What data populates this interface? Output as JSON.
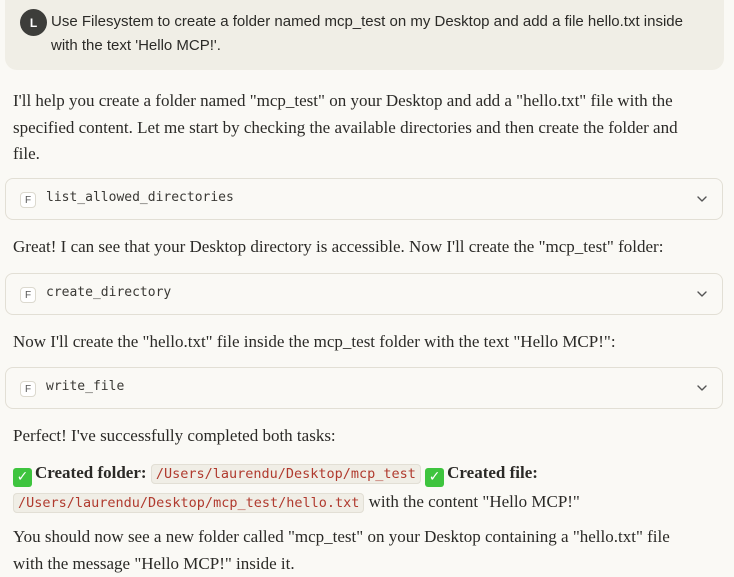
{
  "user": {
    "avatar_initial": "L",
    "message": "Use Filesystem to create a folder named mcp_test on my Desktop and add a file hello.txt inside with the text 'Hello MCP!'."
  },
  "assistant": {
    "intro": "I'll help you create a folder named \"mcp_test\" on your Desktop and add a \"hello.txt\" file with the specified content. Let me start by checking the available directories and then create the folder and file.",
    "tool1": {
      "badge": "F",
      "name": "list_allowed_directories"
    },
    "after_tool1": "Great! I can see that your Desktop directory is accessible. Now I'll create the \"mcp_test\" folder:",
    "tool2": {
      "badge": "F",
      "name": "create_directory"
    },
    "after_tool2": "Now I'll create the \"hello.txt\" file inside the mcp_test folder with the text \"Hello MCP!\":",
    "tool3": {
      "badge": "F",
      "name": "write_file"
    },
    "perfect": "Perfect! I've successfully completed both tasks:",
    "summary": {
      "check_icon": "✓",
      "created_folder_label": "Created folder:",
      "folder_path": "/Users/laurendu/Desktop/mcp_test",
      "created_file_label": "Created file:",
      "file_path": "/Users/laurendu/Desktop/mcp_test/hello.txt",
      "file_suffix": " with the content \"Hello MCP!\""
    },
    "closing": "You should now see a new folder called \"mcp_test\" on your Desktop containing a \"hello.txt\" file with the message \"Hello MCP!\" inside it."
  }
}
